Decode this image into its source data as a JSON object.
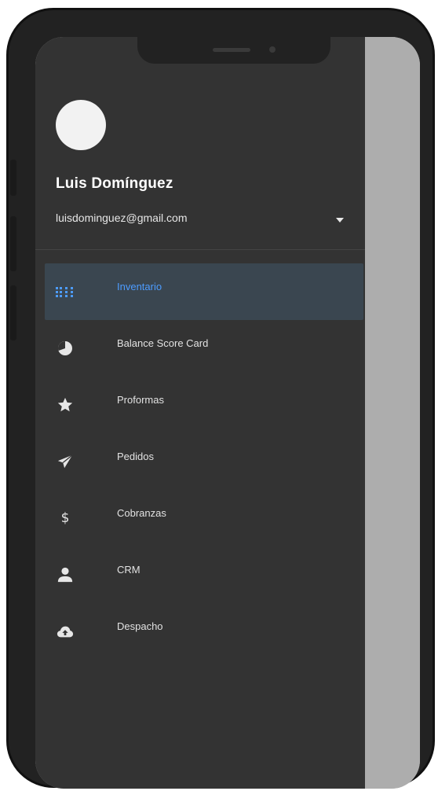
{
  "user": {
    "name": "Luis Domínguez",
    "email": "luisdominguez@gmail.com"
  },
  "menu": {
    "items": [
      {
        "label": "Inventario",
        "icon": "grid-dots-icon",
        "active": true
      },
      {
        "label": "Balance Score Card",
        "icon": "pie-chart-icon",
        "active": false
      },
      {
        "label": "Proformas",
        "icon": "star-icon",
        "active": false
      },
      {
        "label": "Pedidos",
        "icon": "send-icon",
        "active": false
      },
      {
        "label": "Cobranzas",
        "icon": "dollar-icon",
        "active": false
      },
      {
        "label": "CRM",
        "icon": "person-icon",
        "active": false
      },
      {
        "label": "Despacho",
        "icon": "cloud-upload-icon",
        "active": false
      }
    ]
  },
  "colors": {
    "drawer_bg": "#333333",
    "active_bg": "#3a4650",
    "accent": "#4d9cff",
    "scrim": "#adadad"
  }
}
